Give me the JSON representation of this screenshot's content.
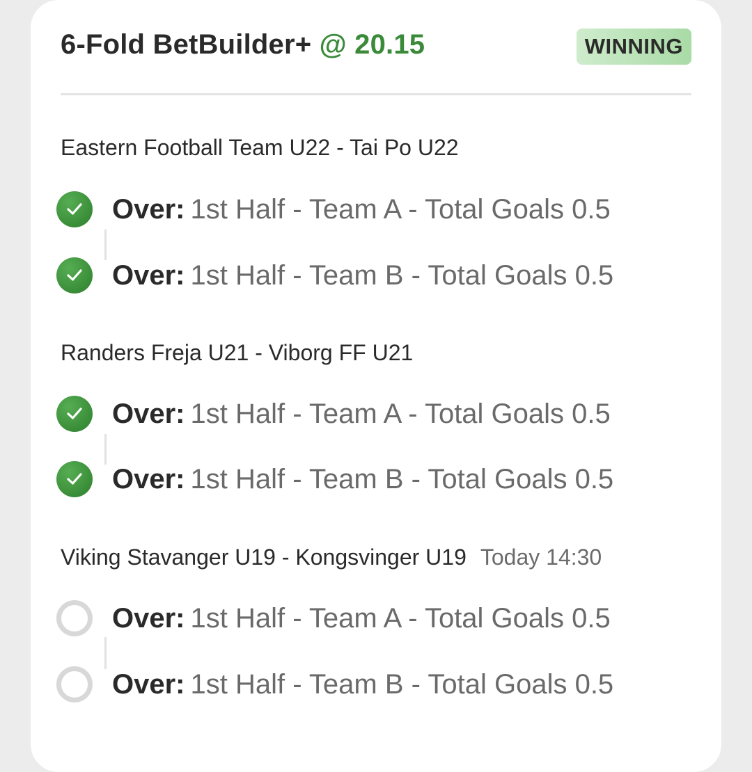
{
  "bet": {
    "title": "6-Fold BetBuilder+",
    "odds": "@ 20.15",
    "status": "WINNING"
  },
  "matches": [
    {
      "name": "Eastern Football Team U22 - Tai Po U22",
      "time": "",
      "legs": [
        {
          "selection": "Over:",
          "market": "1st Half - Team A - Total Goals 0.5",
          "state": "won"
        },
        {
          "selection": "Over:",
          "market": "1st Half - Team B - Total Goals 0.5",
          "state": "won"
        }
      ]
    },
    {
      "name": "Randers Freja U21 - Viborg FF U21",
      "time": "",
      "legs": [
        {
          "selection": "Over:",
          "market": "1st Half - Team A - Total Goals 0.5",
          "state": "won"
        },
        {
          "selection": "Over:",
          "market": "1st Half - Team B - Total Goals 0.5",
          "state": "won"
        }
      ]
    },
    {
      "name": "Viking Stavanger U19 - Kongsvinger U19",
      "time": "Today 14:30",
      "legs": [
        {
          "selection": "Over:",
          "market": "1st Half - Team A - Total Goals 0.5",
          "state": "pending"
        },
        {
          "selection": "Over:",
          "market": "1st Half - Team B - Total Goals 0.5",
          "state": "pending"
        }
      ]
    }
  ],
  "colors": {
    "accent_green": "#3b8a3a",
    "badge_bg": "#bfe4bc",
    "pending_ring": "#d8d8d8"
  },
  "icons": {
    "won": "check-circle-icon",
    "pending": "empty-circle-icon"
  }
}
